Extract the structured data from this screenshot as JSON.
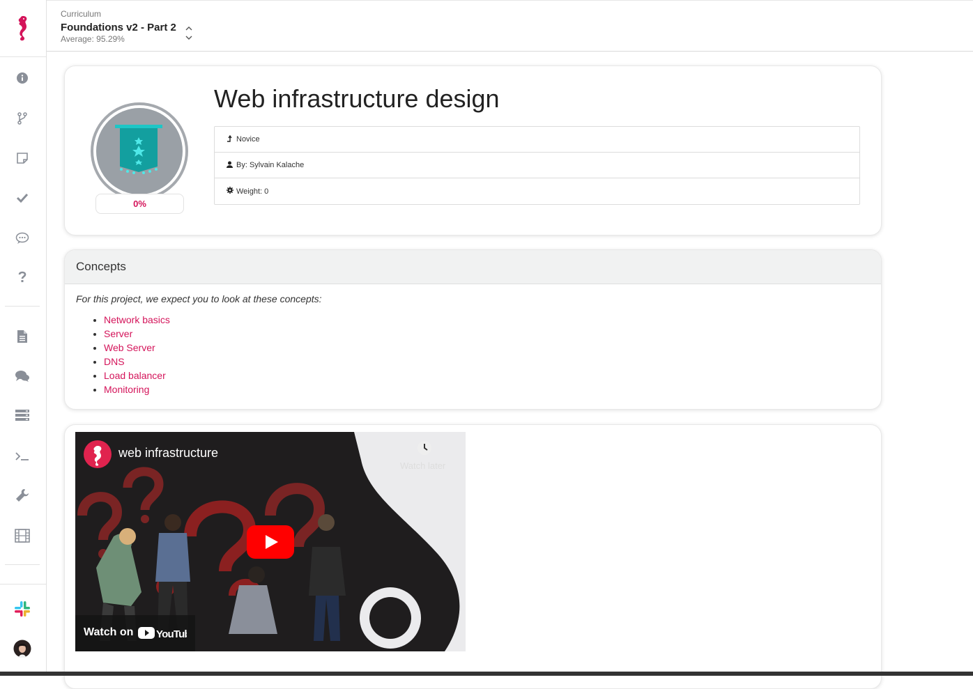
{
  "brand": {
    "accent": "#d4145a"
  },
  "sidebar": {
    "icons": [
      "info-icon",
      "git-branch-icon",
      "sticky-note-icon",
      "check-icon",
      "comments-icon",
      "question-icon",
      "document-icon",
      "chat-icon",
      "servers-icon",
      "terminal-icon",
      "wrench-icon",
      "film-icon"
    ],
    "bottom": [
      "slack-icon",
      "avatar"
    ]
  },
  "header": {
    "label": "Curriculum",
    "title": "Foundations v2 - Part 2",
    "average": "Average: 95.29%"
  },
  "project": {
    "title": "Web infrastructure design",
    "progress": "0%",
    "meta": [
      {
        "icon": "level-up-icon",
        "text": "Novice"
      },
      {
        "icon": "user-icon",
        "text": "By: Sylvain Kalache"
      },
      {
        "icon": "cog-icon",
        "text": "Weight: 0"
      }
    ]
  },
  "concepts": {
    "heading": "Concepts",
    "intro": "For this project, we expect you to look at these concepts:",
    "items": [
      "Network basics",
      "Server",
      "Web Server",
      "DNS",
      "Load balancer",
      "Monitoring"
    ]
  },
  "video": {
    "title": "web infrastructure",
    "watch_later": "Watch later",
    "watch_on": "Watch on"
  }
}
